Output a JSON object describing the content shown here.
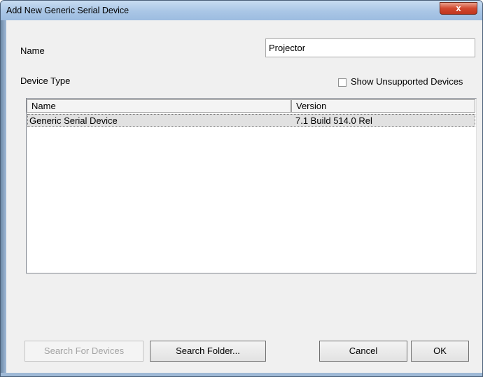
{
  "window": {
    "title": "Add New Generic Serial Device",
    "close_label": "x"
  },
  "form": {
    "name_label": "Name",
    "name_value": "Projector",
    "device_type_label": "Device Type",
    "show_unsupported_label": "Show Unsupported Devices",
    "show_unsupported_checked": false
  },
  "device_list": {
    "columns": [
      "Name",
      "Version"
    ],
    "rows": [
      {
        "name": "Generic Serial Device",
        "version": "7.1 Build 514.0 Rel",
        "selected": true
      }
    ]
  },
  "buttons": {
    "search_devices": "Search For Devices",
    "search_folder": "Search Folder...",
    "cancel": "Cancel",
    "ok": "OK"
  }
}
